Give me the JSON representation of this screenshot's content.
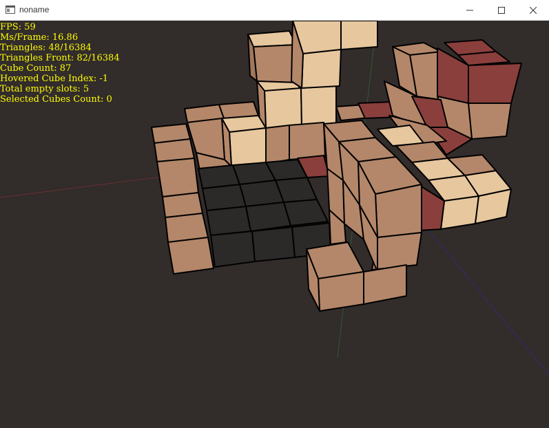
{
  "window": {
    "title": "noname"
  },
  "hud": {
    "fps": "FPS: 59",
    "ms_frame": "Ms/Frame: 16.86",
    "triangles": "Triangles: 48/16384",
    "triangles_front": "Triangles Front: 82/16384",
    "cube_count": "Cube Count: 87",
    "hovered_index": "Hovered Cube Index: -1",
    "empty_slots": "Total empty slots: 5",
    "selected_count": "Selected Cubes Count: 0"
  },
  "colors": {
    "background": "#322c2b",
    "hud_text": "#ffff00",
    "cube_tan": "#b4876a",
    "cube_light": "#e7c79e",
    "cube_red": "#8a3f3c",
    "cube_dark": "#2c2a29"
  }
}
